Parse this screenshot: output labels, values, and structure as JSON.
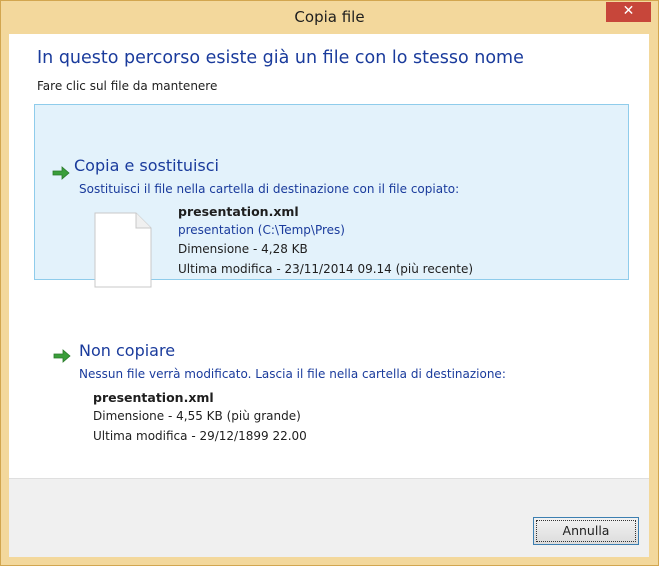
{
  "window": {
    "title": "Copia file",
    "close_glyph": "✕"
  },
  "heading": "In questo percorso esiste già un file con lo stesso nome",
  "subheading": "Fare clic sul file da mantenere",
  "option_copy": {
    "title": "Copia e sostituisci",
    "description": "Sostituisci il file nella cartella di destinazione con il file copiato:",
    "file_name": "presentation.xml",
    "file_path": "presentation (C:\\Temp\\Pres)",
    "size": "Dimensione - 4,28 KB",
    "modified": "Ultima modifica - 23/11/2014 09.14 (più recente)",
    "icon": "green-arrow-icon"
  },
  "option_skip": {
    "title": "Non copiare",
    "description": "Nessun file verrà modificato. Lascia il file nella cartella di destinazione:",
    "file_name": "presentation.xml",
    "size": "Dimensione - 4,55 KB (più grande)",
    "modified": "Ultima modifica - 29/12/1899 22.00",
    "icon": "green-arrow-icon"
  },
  "footer": {
    "cancel_label": "Annulla"
  },
  "colors": {
    "frame": "#f3d89c",
    "close_button": "#c7463a",
    "link_blue": "#1a3b9c",
    "selected_bg": "#e3f2fb",
    "selected_border": "#8fcceb",
    "arrow_green": "#3a9e3a"
  }
}
